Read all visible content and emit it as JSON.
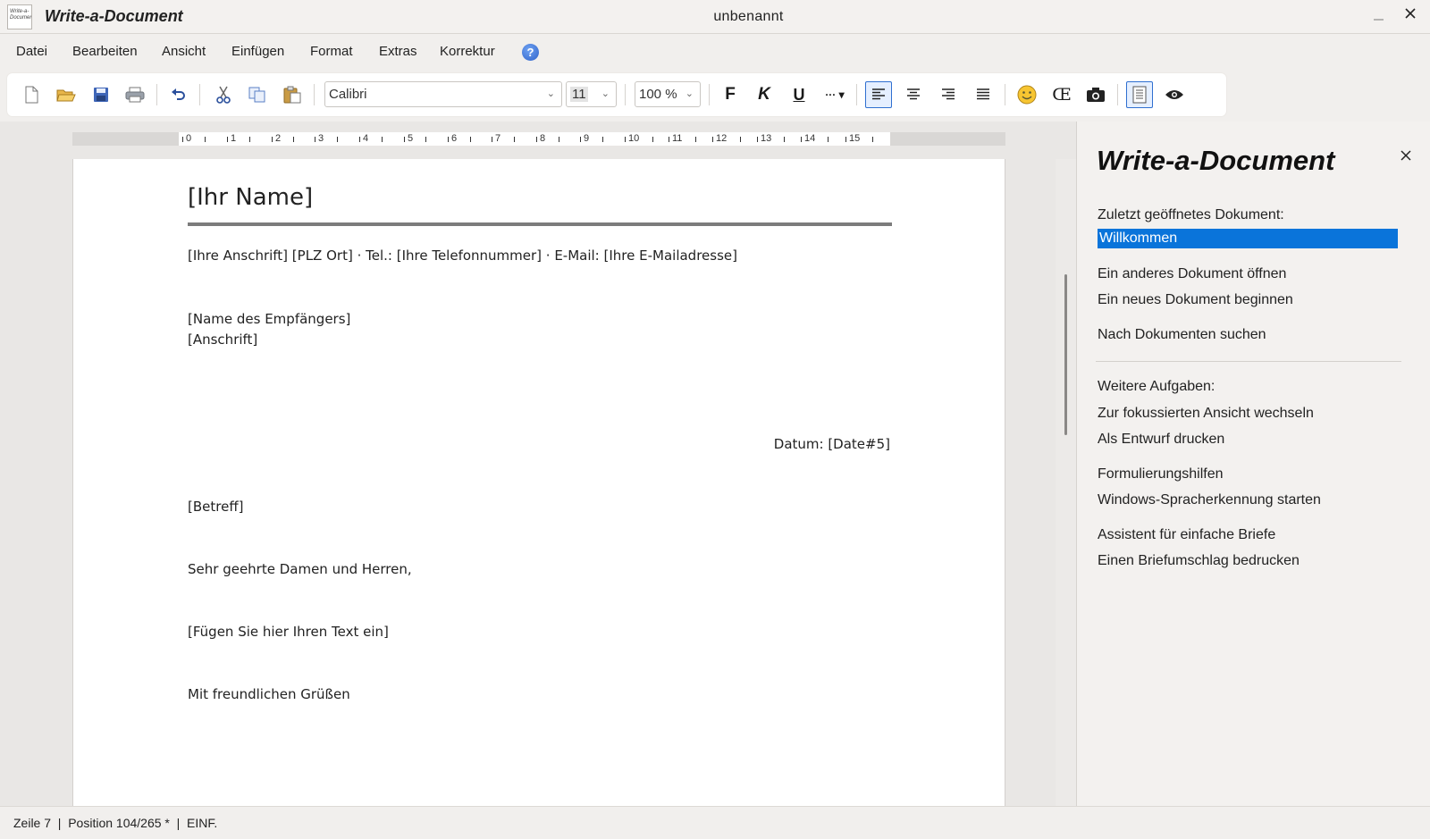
{
  "window": {
    "app_title": "Write-a-Document",
    "doc_title": "unbenannt",
    "icon_text": [
      "Write-a-",
      "Document"
    ]
  },
  "menu": [
    {
      "label": "Datei",
      "name": "menu-datei"
    },
    {
      "label": "Bearbeiten",
      "name": "menu-bearbeiten"
    },
    {
      "label": "Ansicht",
      "name": "menu-ansicht"
    },
    {
      "label": "Einfügen",
      "name": "menu-einfuegen"
    },
    {
      "label": "Format",
      "name": "menu-format"
    },
    {
      "label": "Extras",
      "name": "menu-extras"
    },
    {
      "label": "Korrektur",
      "name": "menu-korrektur"
    }
  ],
  "toolbar": {
    "font": "Calibri",
    "size": "11",
    "zoom": "100 %",
    "bold": "F",
    "italic": "K",
    "underline": "U",
    "more": "··· ▾"
  },
  "ruler": {
    "labels": [
      "0",
      "1",
      "2",
      "3",
      "4",
      "5",
      "6",
      "7",
      "8",
      "9",
      "10",
      "11",
      "12",
      "13",
      "14",
      "15"
    ]
  },
  "document": {
    "name": "[Ihr Name]",
    "address_line": "[Ihre Anschrift] [PLZ Ort] · Tel.: [Ihre Telefonnummer] · E-Mail: [Ihre E-Mailadresse]",
    "recipient_name": "[Name des Empfängers]",
    "recipient_address": "[Anschrift]",
    "date": "Datum: [Date#5]",
    "subject": "[Betreff]",
    "salutation": "Sehr geehrte Damen und Herren,",
    "body": "[Fügen Sie hier Ihren Text ein]",
    "closing": "Mit freundlichen Grüßen"
  },
  "panel": {
    "title": "Write-a-Document",
    "recent_label": "Zuletzt geöffnetes Dokument:",
    "recent_item": "Willkommen",
    "open_other": "Ein anderes Dokument öffnen",
    "new_doc": "Ein neues Dokument beginnen",
    "search_docs": "Nach Dokumenten suchen",
    "more_tasks": "Weitere Aufgaben:",
    "focus_view": "Zur fokussierten Ansicht wechseln",
    "print_draft": "Als Entwurf drucken",
    "phrasing": "Formulierungshilfen",
    "speech": "Windows-Spracherkennung starten",
    "letter_wizard": "Assistent für einfache Briefe",
    "envelope": "Einen Briefumschlag bedrucken"
  },
  "status": {
    "text": "Zeile 7  |  Position 104/265 *  |  EINF."
  },
  "colors": {
    "selection": "#0a74da",
    "help_icon": "#2f62c9"
  }
}
